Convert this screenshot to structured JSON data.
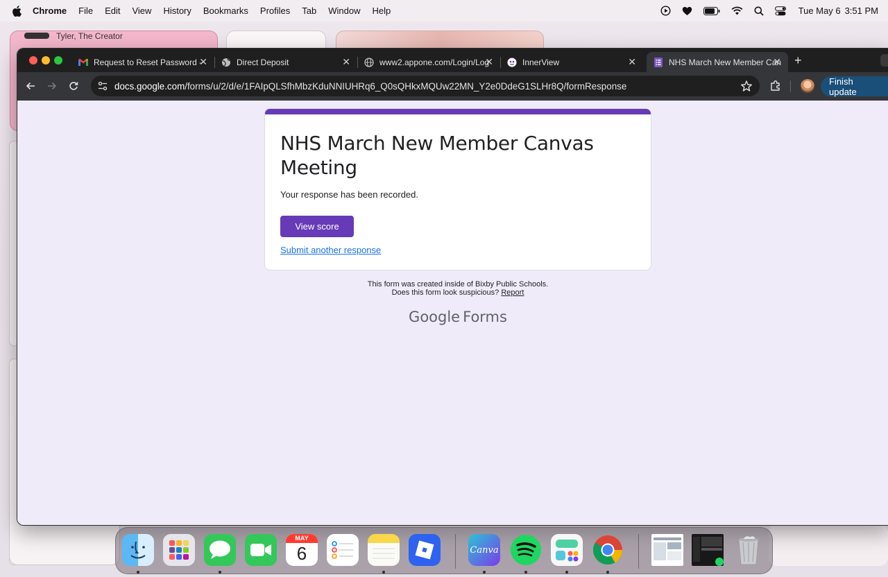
{
  "menubar": {
    "app_name": "Chrome",
    "items": [
      "File",
      "Edit",
      "View",
      "History",
      "Bookmarks",
      "Profiles",
      "Tab",
      "Window",
      "Help"
    ],
    "date": "Tue May 6",
    "time": "3:51 PM"
  },
  "background": {
    "pink_window_label": "Tyler, The Creator"
  },
  "tabs": [
    {
      "title": "Request to Reset Password -",
      "icon": "gmail-icon"
    },
    {
      "title": "Direct Deposit",
      "icon": "globe-icon"
    },
    {
      "title": "www2.appone.com/Login/Log",
      "icon": "globe-icon"
    },
    {
      "title": "InnerView",
      "icon": "innerview-icon"
    },
    {
      "title": "NHS March New Member Can",
      "icon": "google-forms-icon",
      "active": true
    }
  ],
  "toolbar": {
    "url_host": "docs.google.com",
    "url_path": "/forms/u/2/d/e/1FAIpQLSfhMbzKduNNIUHRq6_Q0sQHkxMQUw22MN_Y2e0DdeG1SLHr8Q/formResponse",
    "finish_update_label": "Finish update"
  },
  "form": {
    "title": "NHS March New Member Canvas Meeting",
    "message": "Your response has been recorded.",
    "view_score_label": "View score",
    "submit_another_label": "Submit another response",
    "accent_color": "#673ab7"
  },
  "footer": {
    "line1": "This form was created inside of Bixby Public Schools.",
    "line2_prefix": "Does this form look suspicious?",
    "report_label": "Report",
    "brand_google": "Google",
    "brand_forms": "Forms"
  },
  "dock": {
    "calendar_month": "MAY",
    "calendar_day": "6",
    "canva_label": "Canva",
    "apps": [
      "finder-icon",
      "launchpad-icon",
      "messages-icon",
      "facetime-icon",
      "calendar-icon",
      "reminders-icon",
      "notes-icon",
      "roblox-icon",
      "canva-icon",
      "spotify-icon",
      "widget-app-icon",
      "chrome-icon",
      "recent-doc-icon",
      "recent-spotify-icon",
      "trash-icon"
    ]
  }
}
